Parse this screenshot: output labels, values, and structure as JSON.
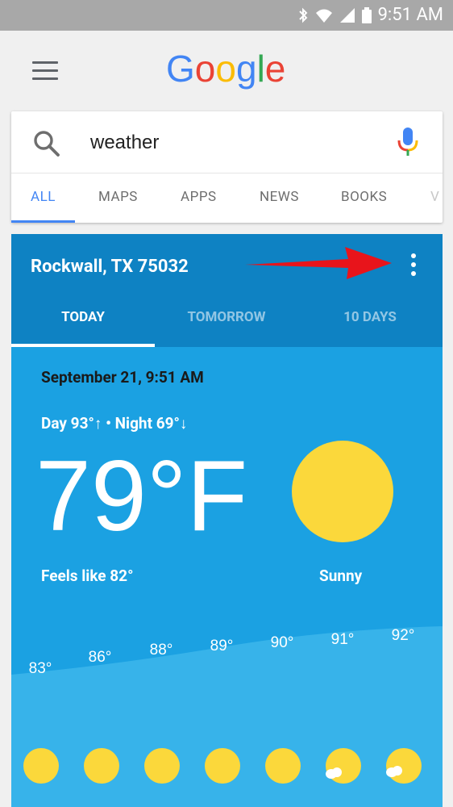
{
  "status": {
    "time": "9:51 AM"
  },
  "header": {
    "logo": [
      "G",
      "o",
      "o",
      "g",
      "l",
      "e"
    ]
  },
  "search": {
    "query": "weather"
  },
  "tabs": [
    "ALL",
    "MAPS",
    "APPS",
    "NEWS",
    "BOOKS",
    "V"
  ],
  "weather": {
    "location": "Rockwall, TX 75032",
    "tabs": [
      "TODAY",
      "TOMORROW",
      "10 DAYS"
    ],
    "date": "September 21, 9:51 AM",
    "day_night": "Day 93°↑ • Night 69°↓",
    "temperature": "79°F",
    "feels_like": "Feels like 82°",
    "condition": "Sunny",
    "hourly": [
      "83°",
      "86°",
      "88°",
      "89°",
      "90°",
      "91°",
      "92°"
    ]
  },
  "colors": {
    "header_blue": "#0e82c3",
    "body_blue": "#1ba1e2",
    "sun_yellow": "#fbd83b",
    "google_blue": "#4285f4",
    "google_red": "#ea4335",
    "google_yellow": "#fbbc05",
    "google_green": "#34a853"
  },
  "icons": {
    "statusbar": [
      "bluetooth-icon",
      "wifi-icon",
      "signal-icon",
      "battery-icon"
    ],
    "search": "search-icon",
    "voice": "mic-icon",
    "menu": "hamburger-menu-icon",
    "overflow": "more-vert-icon",
    "annotation": "red-arrow-icon"
  }
}
